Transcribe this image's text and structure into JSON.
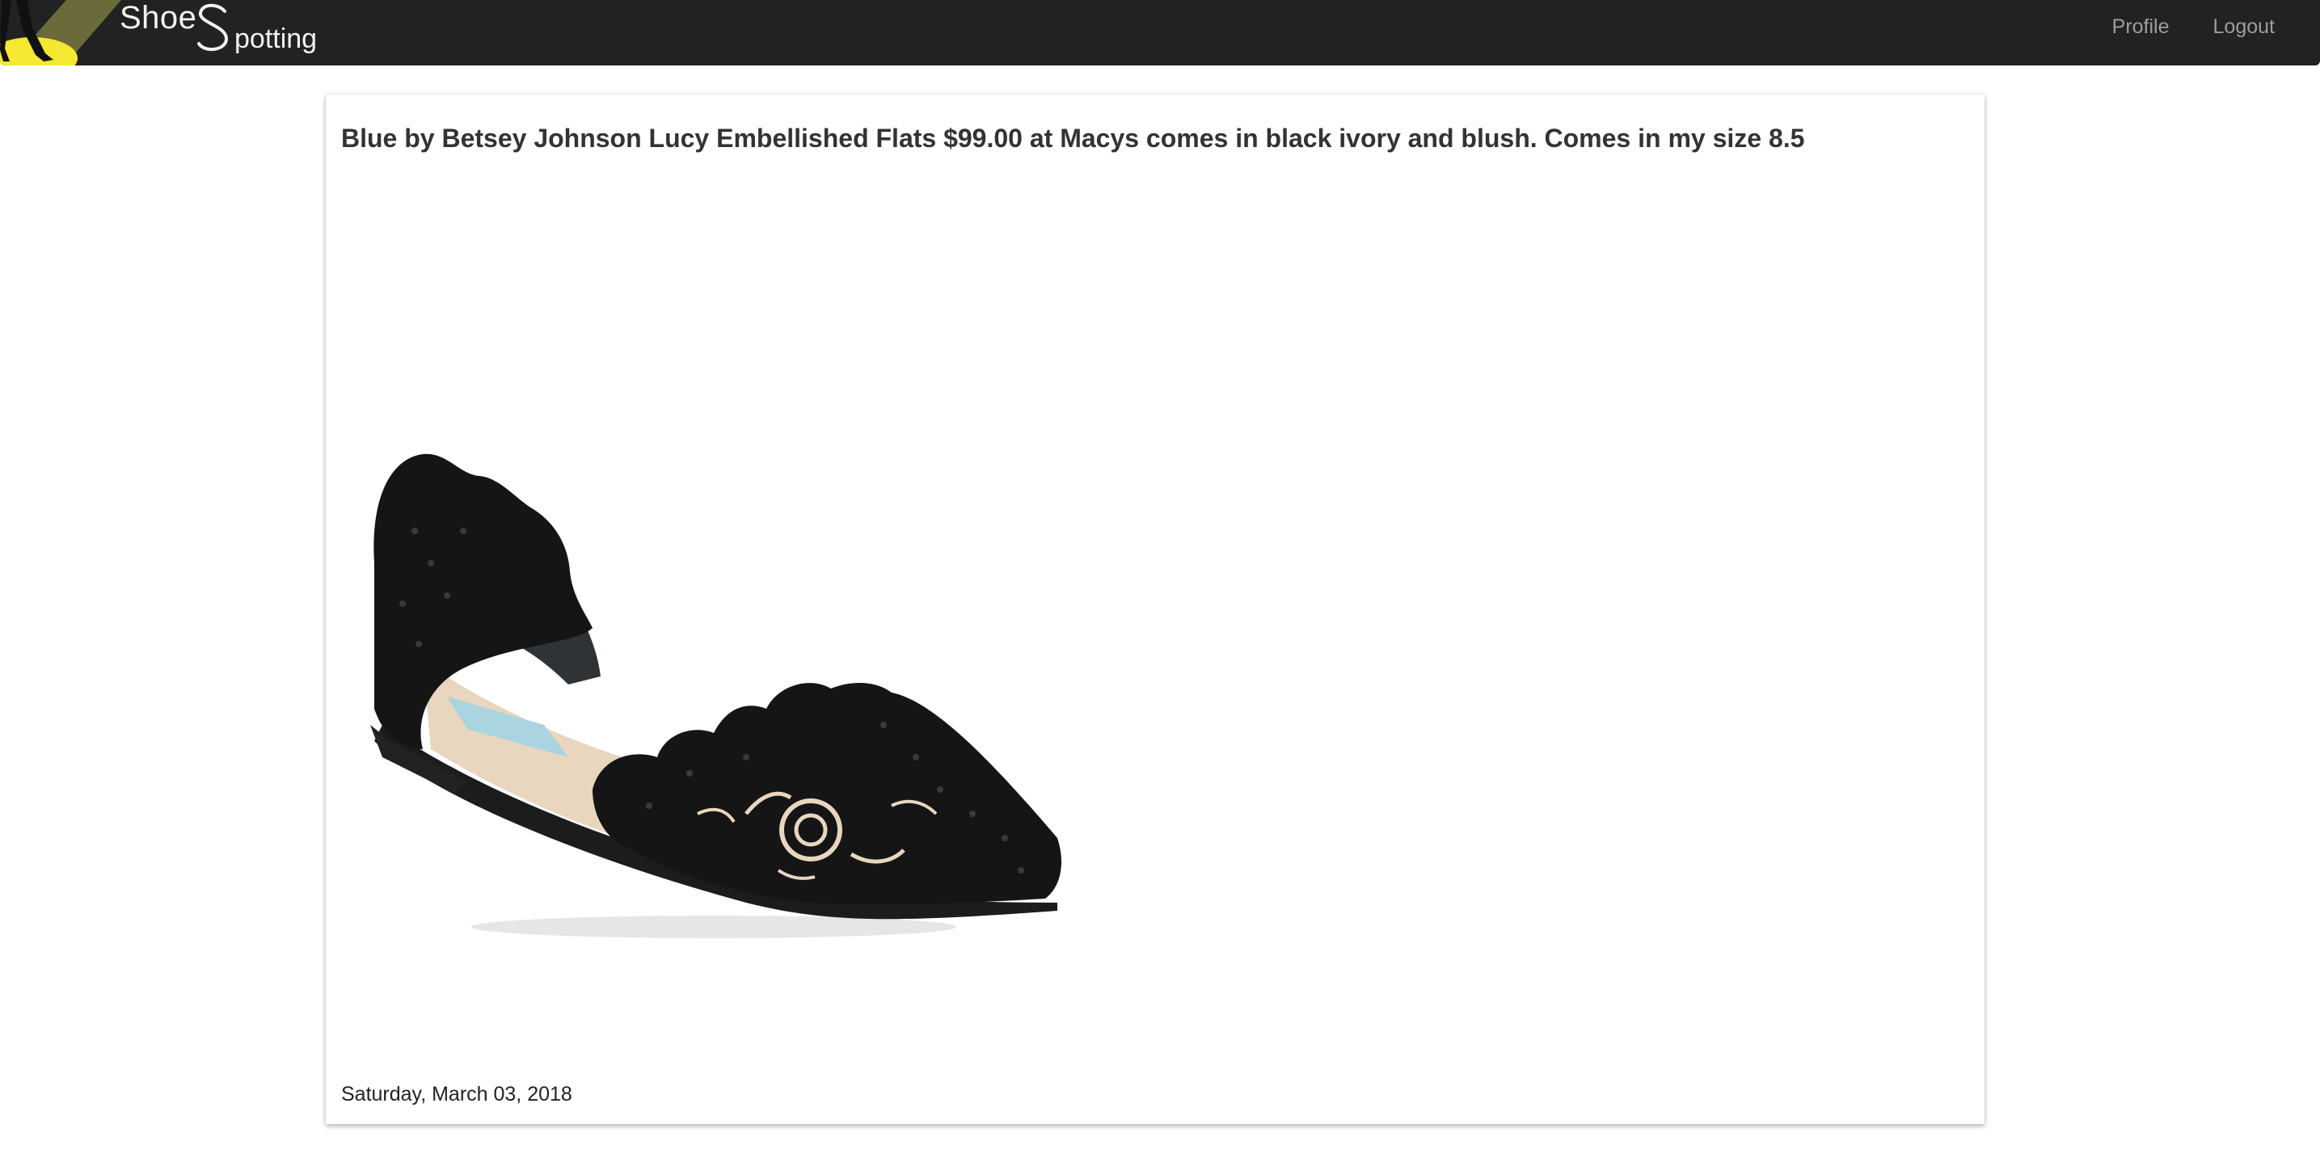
{
  "navbar": {
    "brand": {
      "word_one": "Shoe",
      "word_two": "potting",
      "logo_icon": "spotlight-legs-logo-icon"
    },
    "links": [
      {
        "label": "Profile"
      },
      {
        "label": "Logout"
      }
    ]
  },
  "post": {
    "title": "Blue by Betsey Johnson Lucy Embellished Flats $99.00 at Macys comes in black ivory and blush. Comes in my size 8.5",
    "image_subject": "black-embellished-pointed-flat-shoe",
    "date": "Saturday, March 03, 2018"
  },
  "colors": {
    "navbar_bg": "#222222",
    "nav_link": "#9d9d9d",
    "brand_text": "#f2f2f2",
    "logo_spotlight": "#f4e830",
    "logo_beam": "#6b6a3a",
    "title_text": "#333333",
    "shoe_black": "#141414",
    "shoe_lining": "#e8d6bf",
    "shoe_label": "#a9d4e0"
  }
}
